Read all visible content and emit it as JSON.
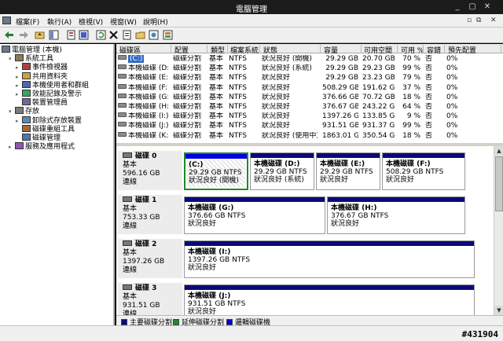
{
  "window": {
    "title": "電腦管理"
  },
  "menu": [
    "檔案(F)",
    "執行(A)",
    "檢視(V)",
    "視窗(W)",
    "說明(H)"
  ],
  "tree": [
    {
      "label": "電腦管理 (本機)",
      "level": 0,
      "icon": "computer-icon"
    },
    {
      "label": "系統工具",
      "level": 1,
      "icon": "tools-icon",
      "twisty": "−"
    },
    {
      "label": "事件檢視器",
      "level": 2,
      "icon": "event-viewer-icon",
      "twisty": "+"
    },
    {
      "label": "共用資料夾",
      "level": 2,
      "icon": "shared-folder-icon",
      "twisty": "+"
    },
    {
      "label": "本機使用者和群組",
      "level": 2,
      "icon": "users-icon",
      "twisty": "+"
    },
    {
      "label": "效能記錄及警示",
      "level": 2,
      "icon": "performance-icon",
      "twisty": "+"
    },
    {
      "label": "裝置管理員",
      "level": 2,
      "icon": "device-manager-icon"
    },
    {
      "label": "存放",
      "level": 1,
      "icon": "storage-icon",
      "twisty": "−"
    },
    {
      "label": "卸除式存放裝置",
      "level": 2,
      "icon": "removable-storage-icon",
      "twisty": "+"
    },
    {
      "label": "磁碟重組工具",
      "level": 2,
      "icon": "defrag-icon"
    },
    {
      "label": "磁碟管理",
      "level": 2,
      "icon": "disk-management-icon"
    },
    {
      "label": "服務及應用程式",
      "level": 1,
      "icon": "services-icon",
      "twisty": "+"
    }
  ],
  "columns": [
    "磁碟區",
    "配置",
    "類型",
    "檔案系統",
    "狀態",
    "容量",
    "可用空間",
    "可用 %",
    "容錯",
    "預先配置"
  ],
  "volumes": [
    {
      "name": "(C:)",
      "layout": "磁碟分割",
      "type": "基本",
      "fs": "NTFS",
      "status": "狀況良好 (開機)",
      "capacity": "29.29 GB",
      "free": "20.70 GB",
      "pct": "70 %",
      "fault": "否",
      "overhead": "0%"
    },
    {
      "name": "本機磁碟 (D:)",
      "layout": "磁碟分割",
      "type": "基本",
      "fs": "NTFS",
      "status": "狀況良好 (系統)",
      "capacity": "29.29 GB",
      "free": "29.23 GB",
      "pct": "99 %",
      "fault": "否",
      "overhead": "0%"
    },
    {
      "name": "本機磁碟 (E:)",
      "layout": "磁碟分割",
      "type": "基本",
      "fs": "NTFS",
      "status": "狀況良好",
      "capacity": "29.29 GB",
      "free": "23.23 GB",
      "pct": "79 %",
      "fault": "否",
      "overhead": "0%"
    },
    {
      "name": "本機磁碟 (F:)",
      "layout": "磁碟分割",
      "type": "基本",
      "fs": "NTFS",
      "status": "狀況良好",
      "capacity": "508.29 GB",
      "free": "191.62 GB",
      "pct": "37 %",
      "fault": "否",
      "overhead": "0%"
    },
    {
      "name": "本機磁碟 (G:)",
      "layout": "磁碟分割",
      "type": "基本",
      "fs": "NTFS",
      "status": "狀況良好",
      "capacity": "376.66 GB",
      "free": "70.72 GB",
      "pct": "18 %",
      "fault": "否",
      "overhead": "0%"
    },
    {
      "name": "本機磁碟 (H:)",
      "layout": "磁碟分割",
      "type": "基本",
      "fs": "NTFS",
      "status": "狀況良好",
      "capacity": "376.67 GB",
      "free": "243.22 GB",
      "pct": "64 %",
      "fault": "否",
      "overhead": "0%"
    },
    {
      "name": "本機磁碟 (I:)",
      "layout": "磁碟分割",
      "type": "基本",
      "fs": "NTFS",
      "status": "狀況良好",
      "capacity": "1397.26 GB",
      "free": "133.85 GB",
      "pct": "9 %",
      "fault": "否",
      "overhead": "0%"
    },
    {
      "name": "本機磁碟 (J:)",
      "layout": "磁碟分割",
      "type": "基本",
      "fs": "NTFS",
      "status": "狀況良好",
      "capacity": "931.51 GB",
      "free": "931.37 GB",
      "pct": "99 %",
      "fault": "否",
      "overhead": "0%"
    },
    {
      "name": "本機磁碟 (K:)",
      "layout": "磁碟分割",
      "type": "基本",
      "fs": "NTFS",
      "status": "狀況良好 (使用中)",
      "capacity": "1863.01 GB",
      "free": "350.54 GB",
      "pct": "18 %",
      "fault": "否",
      "overhead": "0%"
    }
  ],
  "disks": [
    {
      "name": "磁碟 0",
      "type": "基本",
      "size": "596.16 GB",
      "state": "連線",
      "parts": [
        {
          "title": "(C:)",
          "size": "29.29 GB NTFS",
          "status": "狀況良好 (開機)",
          "selected": true
        },
        {
          "title": "本機磁碟 (D:)",
          "size": "29.29 GB NTFS",
          "status": "狀況良好 (系統)"
        },
        {
          "title": "本機磁碟 (E:)",
          "size": "29.29 GB NTFS",
          "status": "狀況良好"
        },
        {
          "title": "本機磁碟 (F:)",
          "size": "508.29 GB NTFS",
          "status": "狀況良好"
        }
      ]
    },
    {
      "name": "磁碟 1",
      "type": "基本",
      "size": "753.33 GB",
      "state": "連線",
      "parts": [
        {
          "title": "本機磁碟 (G:)",
          "size": "376.66 GB NTFS",
          "status": "狀況良好"
        },
        {
          "title": "本機磁碟 (H:)",
          "size": "376.67 GB NTFS",
          "status": "狀況良好"
        }
      ]
    },
    {
      "name": "磁碟 2",
      "type": "基本",
      "size": "1397.26 GB",
      "state": "連線",
      "parts": [
        {
          "title": "本機磁碟 (I:)",
          "size": "1397.26 GB NTFS",
          "status": "狀況良好"
        }
      ]
    },
    {
      "name": "磁碟 3",
      "type": "基本",
      "size": "931.51 GB",
      "state": "連線",
      "parts": [
        {
          "title": "本機磁碟 (J:)",
          "size": "931.51 GB NTFS",
          "status": "狀況良好"
        }
      ]
    }
  ],
  "legend": [
    {
      "label": "主要磁碟分割",
      "color": "#0a0a7a"
    },
    {
      "label": "延伸磁碟分割",
      "color": "#1f8a2a"
    },
    {
      "label": "邏輯磁碟機",
      "color": "#0000e0"
    }
  ],
  "watermark": "#431904"
}
